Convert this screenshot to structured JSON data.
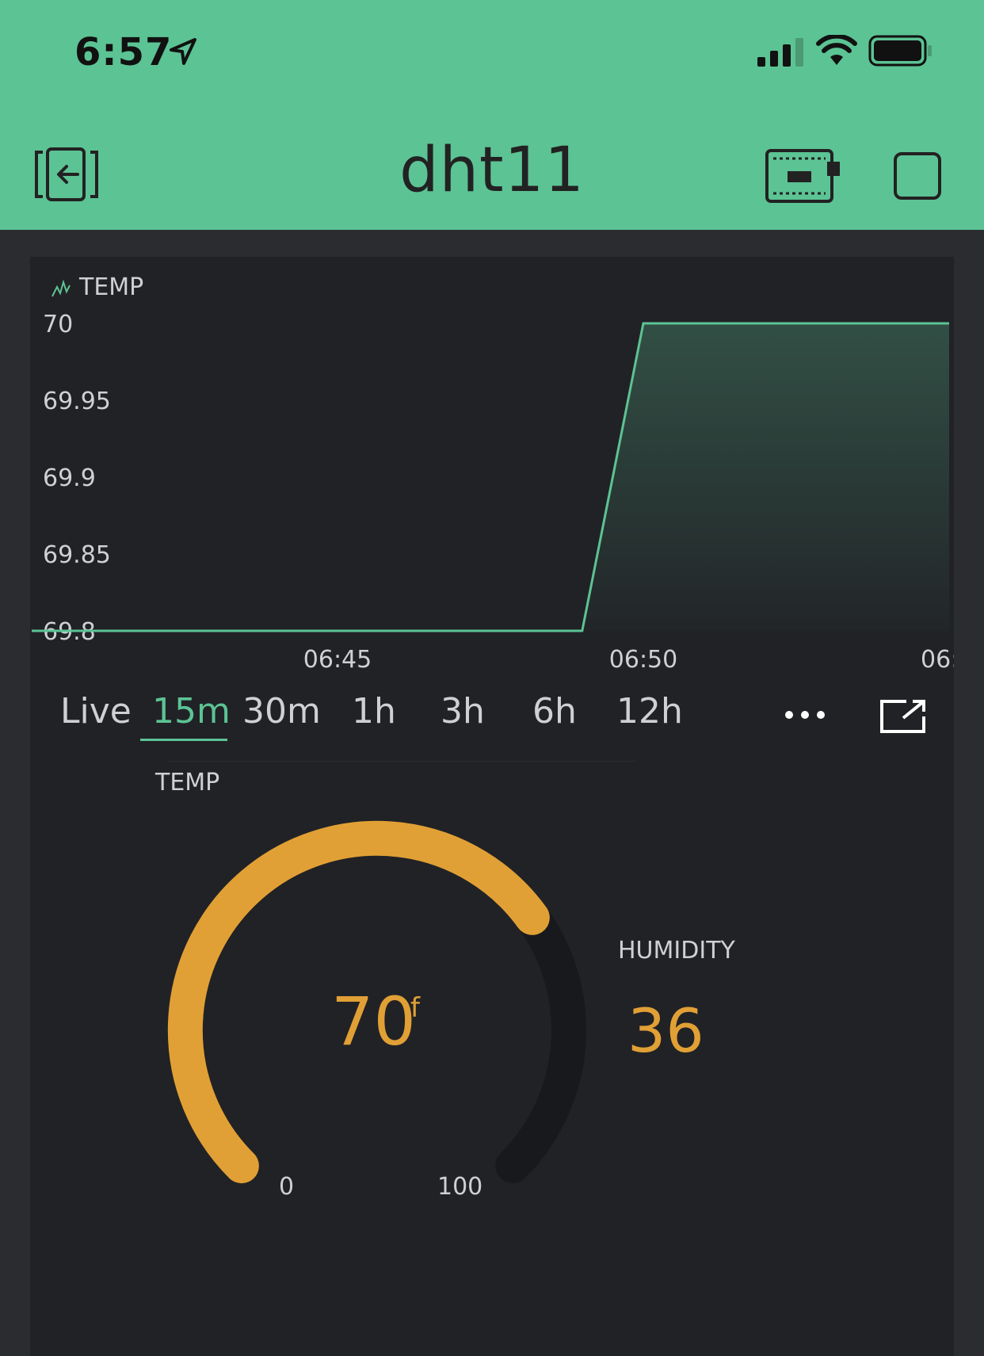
{
  "status_bar": {
    "time": "6:57"
  },
  "header": {
    "title": "dht11"
  },
  "chart": {
    "legend_label": "TEMP",
    "time_tabs": [
      "Live",
      "15m",
      "30m",
      "1h",
      "3h",
      "6h",
      "12h"
    ],
    "active_tab": "15m"
  },
  "chart_data": {
    "type": "area",
    "series": [
      {
        "name": "TEMP",
        "x": [
          "06:41",
          "06:49",
          "06:50",
          "06:55"
        ],
        "values": [
          69.8,
          69.8,
          70,
          70
        ]
      }
    ],
    "ylim": [
      69.8,
      70
    ],
    "y_ticks": [
      "70",
      "69.95",
      "69.9",
      "69.85",
      "69.8"
    ],
    "x_ticks": [
      "06:45",
      "06:50",
      "06:"
    ],
    "grid": false,
    "color": "#5cc394"
  },
  "gauge": {
    "label": "TEMP",
    "value": "70",
    "unit": "f",
    "min": "0",
    "max": "100",
    "fraction": 0.7,
    "color": "#e1a035"
  },
  "humidity": {
    "label": "HUMIDITY",
    "value": "36"
  },
  "colors": {
    "header": "#5cc394",
    "accent": "#5cc394",
    "gauge": "#e1a035",
    "panel": "#212226",
    "background": "#2b2c30"
  }
}
